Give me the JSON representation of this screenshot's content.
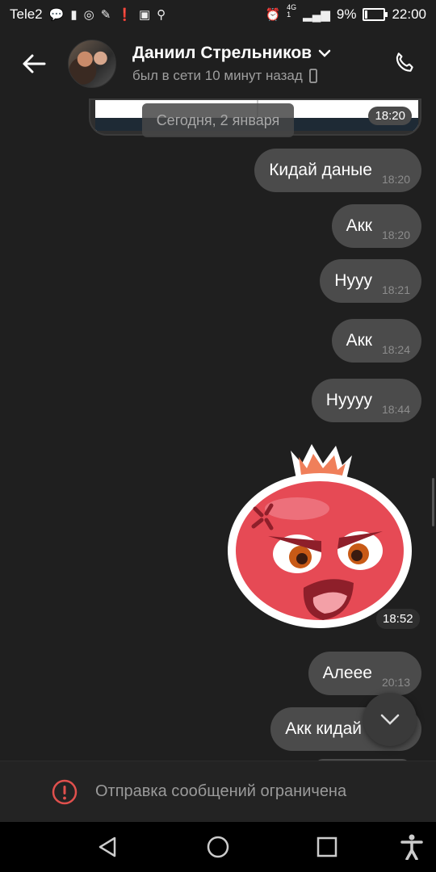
{
  "status_bar": {
    "carrier": "Tele2",
    "network_top": "4G",
    "network_bottom": "1",
    "battery": "9%",
    "battery_level": 0.09,
    "time": "22:00"
  },
  "header": {
    "contact_name": "Даниил Стрельников",
    "last_seen": "был в сети 10 минут назад"
  },
  "chat": {
    "preview_time": "18:20",
    "date_separator": "Сегодня, 2 января",
    "messages": [
      {
        "text": "Кидай даные",
        "time": "18:20"
      },
      {
        "text": "Акк",
        "time": "18:20"
      },
      {
        "text": "Нууу",
        "time": "18:21"
      },
      {
        "text": "Акк",
        "time": "18:24"
      },
      {
        "text": "Нуууу",
        "time": "18:44"
      },
      {
        "text": "Алеее",
        "time": "20:13"
      },
      {
        "text": "Акк кидай"
      }
    ],
    "sticker_time": "18:52"
  },
  "composer": {
    "restricted_text": "Отправка сообщений ограничена"
  },
  "colors": {
    "background": "#1f1f1f",
    "bubble": "#4b4b4b",
    "alert": "#e0504d"
  }
}
